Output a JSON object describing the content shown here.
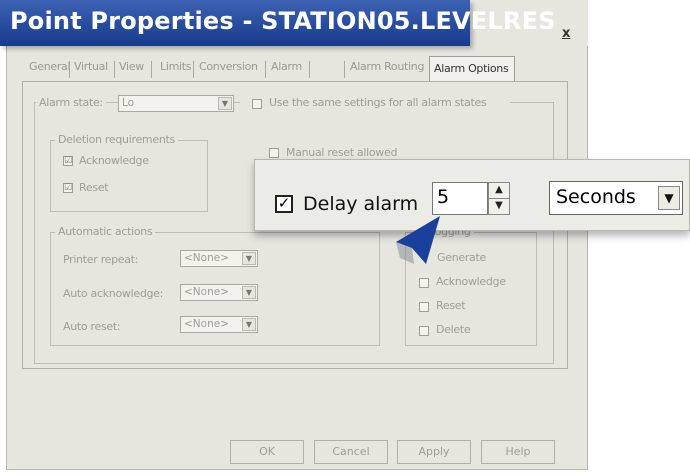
{
  "window": {
    "title": "Point Properties - STATION05.LEVELRES",
    "close_label": "x"
  },
  "tabs": [
    "General",
    "Virtual",
    "View",
    "Limits",
    "Conversion",
    "Alarm",
    "Alarm Routing"
  ],
  "active_tab": "Alarm Options",
  "alarm_state": {
    "label": "Alarm state:",
    "value": "Lo",
    "same_settings_label": "Use the same settings for all alarm states"
  },
  "deletion": {
    "title": "Deletion requirements",
    "acknowledge_label": "Acknowledge",
    "reset_label": "Reset",
    "acknowledge_checked": "☑",
    "reset_checked": "☑"
  },
  "manual_reset_label": "Manual reset allowed",
  "automatic": {
    "title": "Automatic actions",
    "printer_repeat_label": "Printer repeat:",
    "printer_repeat_value": "<None>",
    "auto_ack_label": "Auto acknowledge:",
    "auto_ack_value": "<None>",
    "auto_reset_label": "Auto reset:",
    "auto_reset_value": "<None>"
  },
  "logging": {
    "title": "Logging",
    "generate_label": "Generate",
    "acknowledge_label": "Acknowledge",
    "reset_label": "Reset",
    "delete_label": "Delete"
  },
  "buttons": {
    "ok": "OK",
    "cancel": "Cancel",
    "apply": "Apply",
    "help": "Help"
  },
  "zoom": {
    "delay_label": "Delay alarm",
    "delay_value": "5",
    "unit_value": "Seconds",
    "check_mark": "✓"
  },
  "colors": {
    "title_bar": "#1f4596",
    "arrow": "#1b3f9c",
    "dialog_bg": "#e6e5de"
  }
}
